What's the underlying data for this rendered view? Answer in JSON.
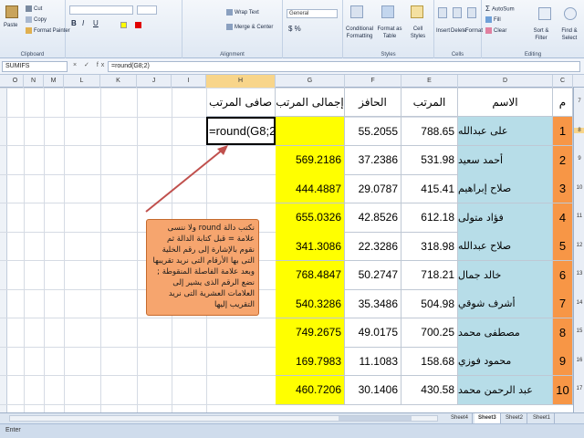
{
  "ribbon": {
    "clipboard": {
      "label": "Clipboard",
      "paste": "Paste",
      "cut": "Cut",
      "copy": "Copy",
      "format_painter": "Format Painter"
    },
    "alignment": {
      "label": "Alignment",
      "wrap_text": "Wrap Text",
      "merge_center": "Merge & Center"
    },
    "number": {
      "format": "General"
    },
    "styles": {
      "label": "Styles",
      "conditional": "Conditional Formatting",
      "format_table": "Format as Table",
      "cell_styles": "Cell Styles"
    },
    "cells": {
      "label": "Cells",
      "insert": "Insert",
      "delete": "Delete",
      "format": "Format"
    },
    "editing": {
      "label": "Editing",
      "autosum": "AutoSum",
      "fill": "Fill",
      "clear": "Clear",
      "sort_filter": "Sort & Filter",
      "find_select": "Find & Select"
    },
    "colors": {
      "accent": "#dfe8f3"
    }
  },
  "formula_bar": {
    "name_box": "SUMIFS",
    "buttons": "× ✓ fx",
    "formula": "=round(G8;2)"
  },
  "columns": [
    "O",
    "N",
    "M",
    "L",
    "K",
    "J",
    "I",
    "H",
    "G",
    "F",
    "E",
    "D",
    "C"
  ],
  "row_numbers": [
    "7",
    "8",
    "9",
    "10",
    "11",
    "12",
    "13",
    "14",
    "15",
    "16",
    "17"
  ],
  "sheet": {
    "headers": {
      "net": "صافى المرتب",
      "total": "إجمالى المرتب",
      "incentive": "الحافز",
      "salary": "المرتب",
      "name": "الاسم",
      "idx": "م"
    },
    "editing_cell": "=round(G8;2)",
    "rows": [
      {
        "idx": "1",
        "name": "على عبدالله",
        "salary": "788.65",
        "incentive": "55.2055",
        "total": ""
      },
      {
        "idx": "2",
        "name": "أحمد سعيد",
        "salary": "531.98",
        "incentive": "37.2386",
        "total": "569.2186"
      },
      {
        "idx": "3",
        "name": "صلاح إبراهيم",
        "salary": "415.41",
        "incentive": "29.0787",
        "total": "444.4887"
      },
      {
        "idx": "4",
        "name": "فؤاد متولى",
        "salary": "612.18",
        "incentive": "42.8526",
        "total": "655.0326"
      },
      {
        "idx": "5",
        "name": "صلاح عبدالله",
        "salary": "318.98",
        "incentive": "22.3286",
        "total": "341.3086"
      },
      {
        "idx": "6",
        "name": "خالد جمال",
        "salary": "718.21",
        "incentive": "50.2747",
        "total": "768.4847"
      },
      {
        "idx": "7",
        "name": "أشرف شوقي",
        "salary": "504.98",
        "incentive": "35.3486",
        "total": "540.3286"
      },
      {
        "idx": "8",
        "name": "مصطفى محمد",
        "salary": "700.25",
        "incentive": "49.0175",
        "total": "749.2675"
      },
      {
        "idx": "9",
        "name": "محمود فوزي",
        "salary": "158.68",
        "incentive": "11.1083",
        "total": "169.7983"
      },
      {
        "idx": "10",
        "name": "عبد الرحمن محمد",
        "salary": "430.58",
        "incentive": "30.1406",
        "total": "460.7206"
      }
    ]
  },
  "callout": "نكتب دالة round ولا ننسى علامة = قبل كتابة الدالة ثم نقوم بالإشارة إلى رقم الخلية التى بها الأرقام التى نريد تقريبها وبعد علامة الفاصلة المنقوطة ; نضع الرقم الذى يشير إلى العلامات العشرية التى نريد التقريب إليها",
  "sheet_tabs": [
    "Sheet4",
    "Sheet3",
    "Sheet2",
    "Sheet1"
  ],
  "status": "Enter"
}
